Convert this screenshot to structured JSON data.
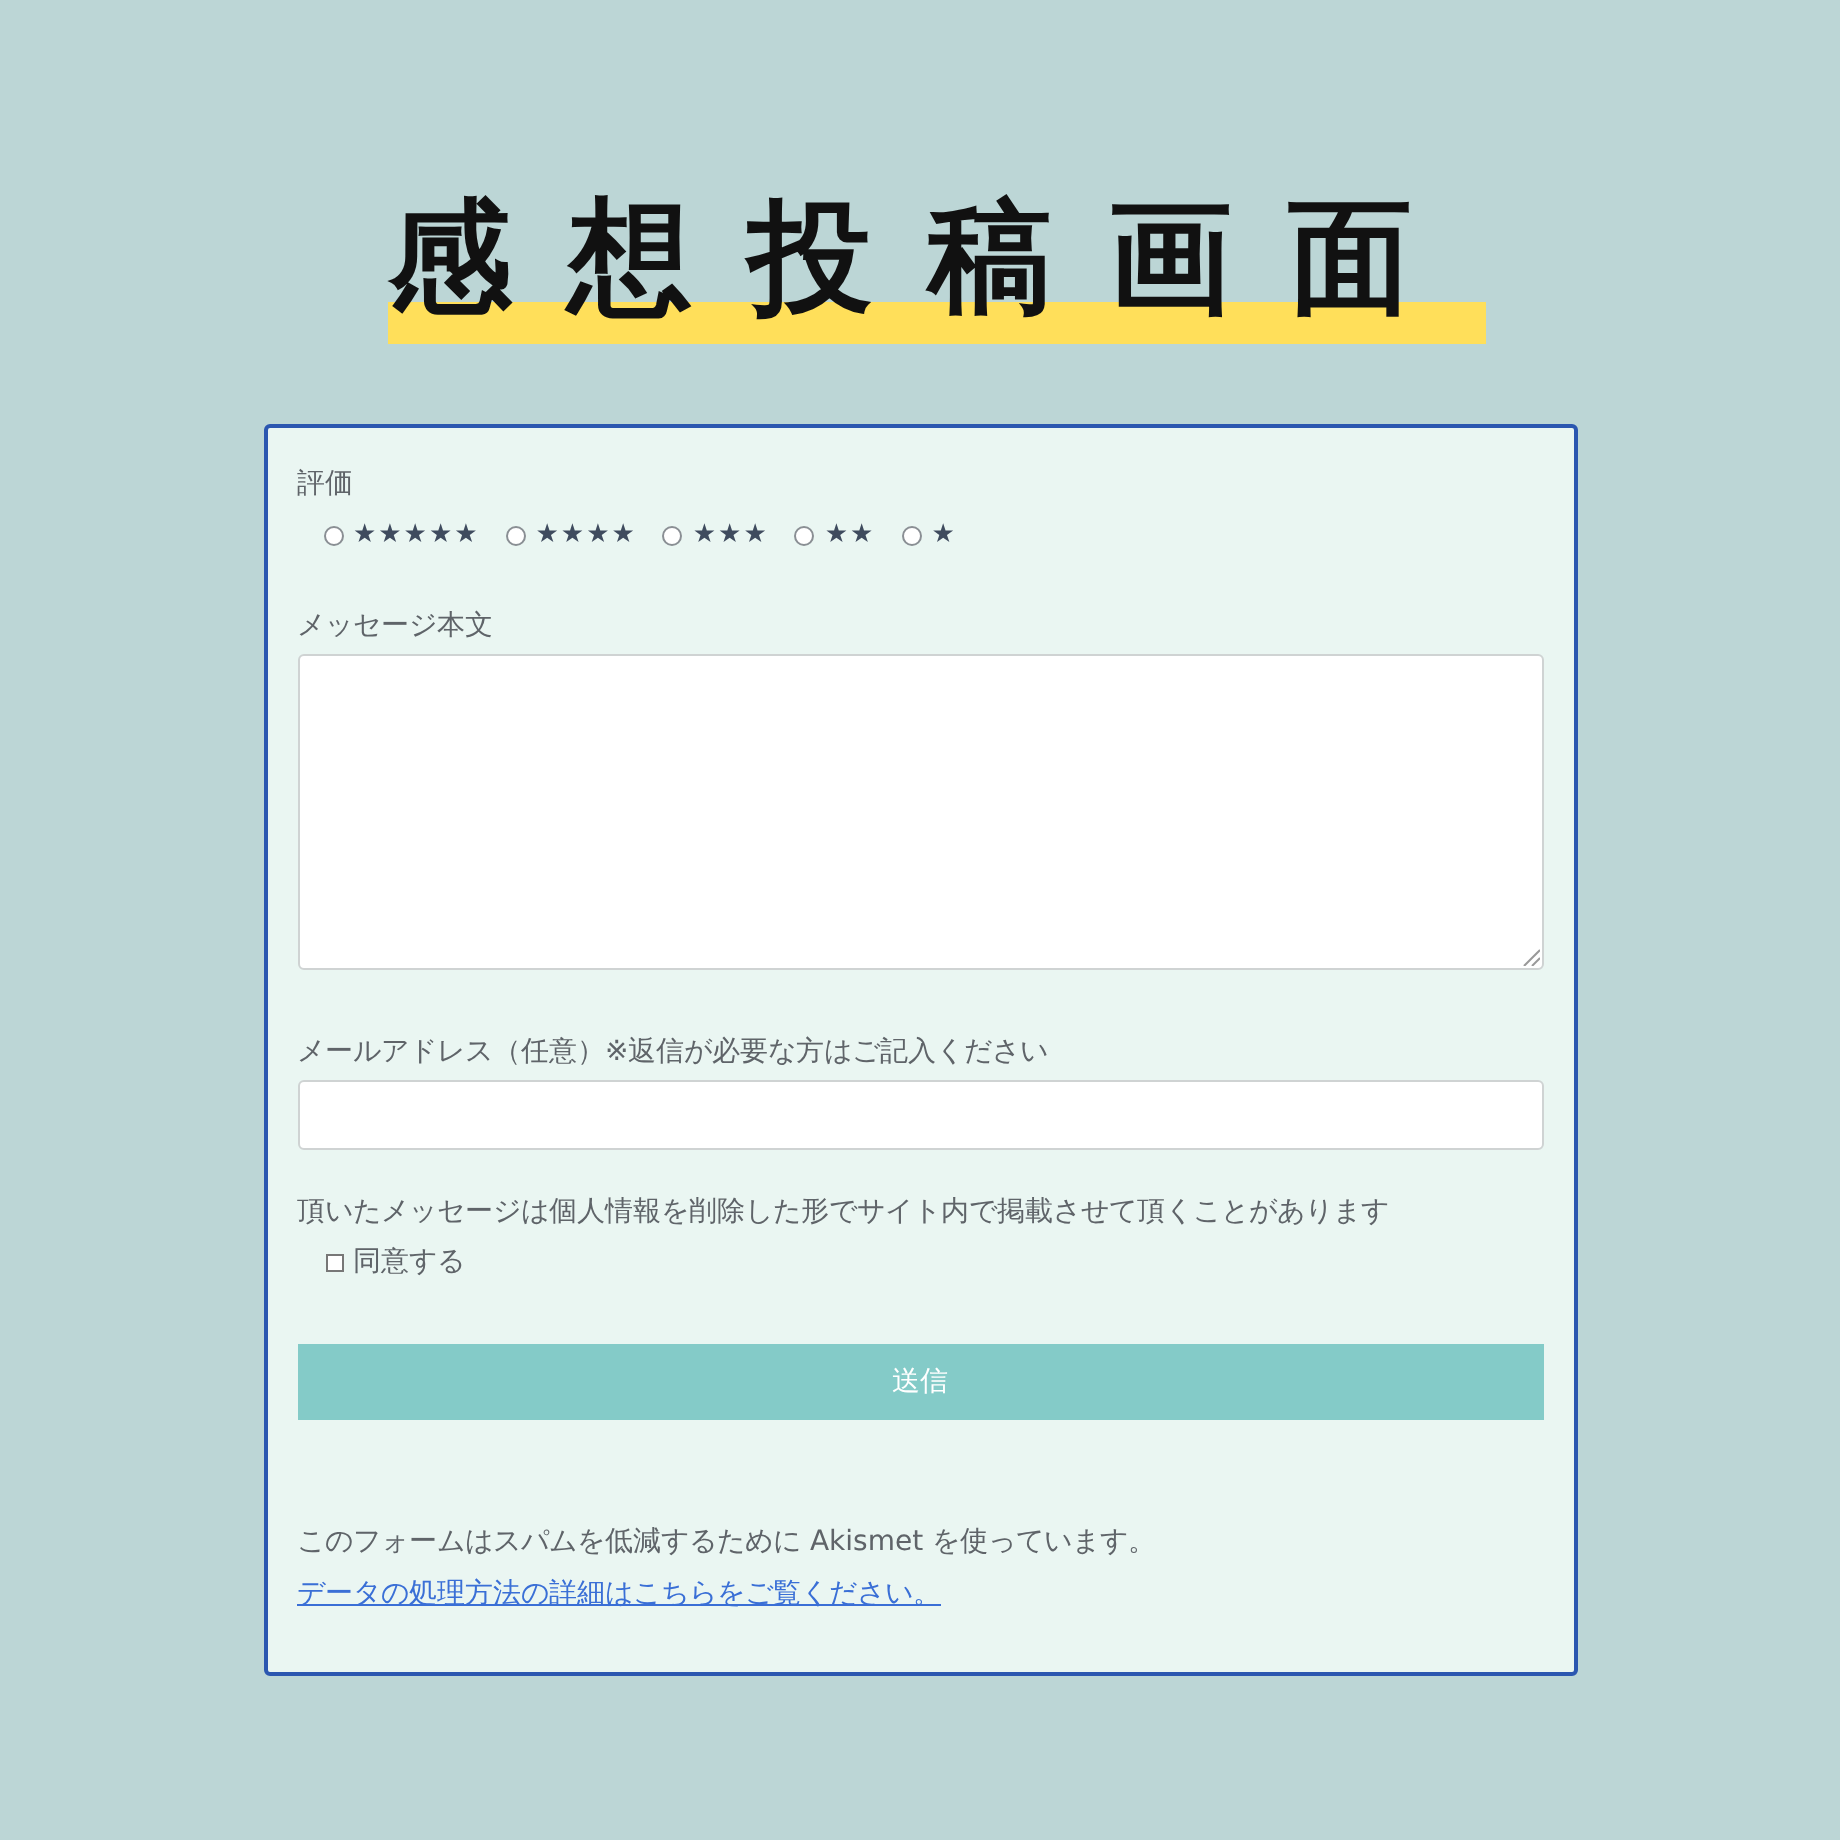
{
  "title": "感想投稿画面",
  "form": {
    "rating": {
      "label": "評価",
      "options": [
        {
          "label": "★★★★★",
          "selected": false
        },
        {
          "label": "★★★★",
          "selected": false
        },
        {
          "label": "★★★",
          "selected": false
        },
        {
          "label": "★★",
          "selected": false
        },
        {
          "label": "★",
          "selected": false
        }
      ]
    },
    "message": {
      "label": "メッセージ本文"
    },
    "email": {
      "label": "メールアドレス（任意）※返信が必要な方はご記入ください"
    },
    "consent": {
      "notice": "頂いたメッセージは個人情報を削除した形でサイト内で掲載させて頂くことがあります",
      "label": "同意する",
      "checked": false
    },
    "submit": "送信",
    "footer": {
      "text": "このフォームはスパムを低減するために Akismet を使っています。",
      "link": "データの処理方法の詳細はこちらをご覧ください。"
    }
  }
}
